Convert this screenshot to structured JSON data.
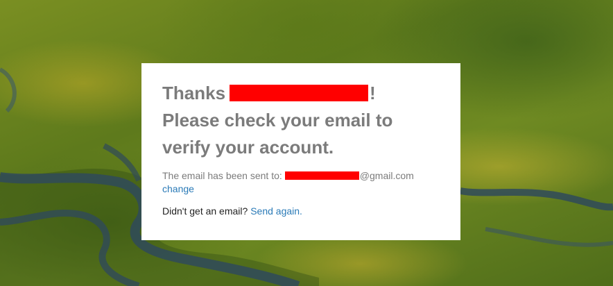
{
  "background": {
    "description": "aerial-rainforest-river-photo"
  },
  "card": {
    "heading_prefix": "Thanks",
    "heading_suffix": "!",
    "heading_line2": "Please check your email to",
    "heading_line3": "verify your account.",
    "sent_label": "The email has been sent to:",
    "email_domain": "@gmail.com",
    "change_link": "change",
    "resend_prompt": "Didn't get an email?",
    "resend_link": "Send again."
  },
  "colors": {
    "heading": "#7b7b7b",
    "link": "#2a7ab7",
    "redaction": "#ff0000",
    "card_bg": "#ffffff"
  }
}
